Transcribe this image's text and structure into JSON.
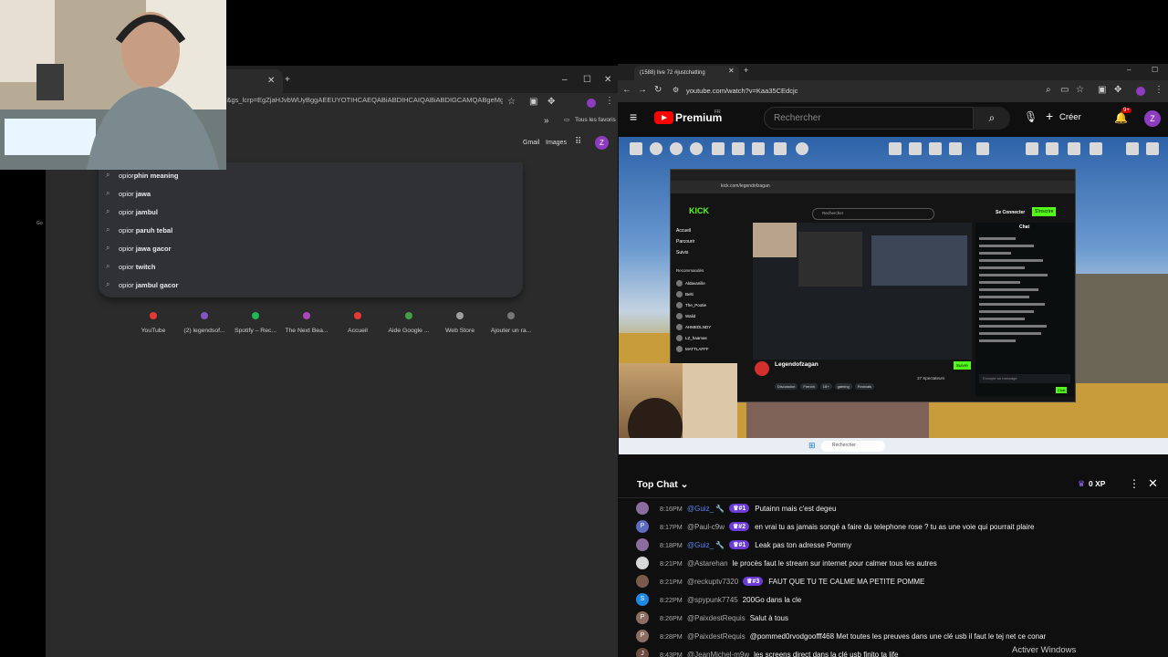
{
  "left_browser": {
    "url": "r&gs_lcrp=EgZjaHJvbWUyBggAEEUYOTIHCAEQABiABDIHCAIQABiABDIGCAMQABgeMgYIBBAA...",
    "bookmark": "Tous les favoris",
    "gmail_label": "Gmail",
    "images_label": "Images",
    "avatar_letter": "Z",
    "suggestions": [
      {
        "prefix": "opior",
        "bold": "phin meaning"
      },
      {
        "prefix": "opior ",
        "bold": "jawa"
      },
      {
        "prefix": "opior ",
        "bold": "jambul"
      },
      {
        "prefix": "opior ",
        "bold": "paruh tebal"
      },
      {
        "prefix": "opior ",
        "bold": "jawa gacor"
      },
      {
        "prefix": "opior ",
        "bold": "twitch"
      },
      {
        "prefix": "opior ",
        "bold": "jambul gacor"
      }
    ],
    "shortcuts": [
      "YouTube",
      "(2) legendsof...",
      "Spotify – Rec...",
      "The Next Bea...",
      "Accueil",
      "Aide Google ...",
      "Web Store",
      "Ajouter un ra..."
    ],
    "shortcut_colors": [
      "#e53935",
      "#7e57c2",
      "#1db954",
      "#ab47bc",
      "#e53935",
      "#43a047",
      "#9e9e9e",
      "#777777"
    ]
  },
  "right_browser": {
    "tab_title": "(1588) live 72 #justchatting",
    "url": "youtube.com/watch?v=Kaa35CEdcjc",
    "brand": "Premium",
    "region": "FR",
    "search_placeholder": "Rechercher",
    "create_label": "Créer",
    "notif_count": "9+",
    "avatar_letter": "Z"
  },
  "video": {
    "kick": {
      "logo": "KICK",
      "url": "kick.com/legendofzagan",
      "search": "Rechercher",
      "connect": "Se Connecter",
      "signup": "S'inscrire",
      "nav": [
        "Accueil",
        "Parcourir",
        "Suivis"
      ],
      "recommended_title": "Recommandés",
      "recommended": [
        "Aldavanille",
        "Belti",
        "The_Pootie",
        "Walid",
        "AHMEDLNDY",
        "LZ_haamas",
        "MATTLAFFF"
      ],
      "streamer": "Legendofzagan",
      "follow": "Suivre",
      "chat_title": "Chat",
      "viewers": "37 Spectateurs",
      "chat_placeholder": "Envoyer un message",
      "chat_button": "Chat",
      "tags": [
        "Discussion",
        "French",
        "18+",
        "gaming",
        "Francais"
      ]
    },
    "taskbar_search": "Rechercher"
  },
  "chat": {
    "title": "Top Chat",
    "xp": "0 XP",
    "messages": [
      {
        "time": "8:16 PM",
        "author": "@Guiz_",
        "mod": true,
        "rank": "#1",
        "text": "Putainn mais c'est degeu",
        "avatar_color": "#8a6d9e",
        "avatar_letter": ""
      },
      {
        "time": "8:17 PM",
        "author": "@Paul-c9w",
        "mod": false,
        "rank": "#2",
        "text": "en vrai tu as jamais songé a faire du telephone rose ? tu as une voie qui pourrait plaire",
        "avatar_color": "#5c6bc0",
        "avatar_letter": "P"
      },
      {
        "time": "8:18 PM",
        "author": "@Guiz_",
        "mod": true,
        "rank": "#1",
        "text": "Leak pas ton adresse Pommy",
        "avatar_color": "#8a6d9e",
        "avatar_letter": ""
      },
      {
        "time": "8:21 PM",
        "author": "@Astarehan",
        "mod": false,
        "rank": "",
        "text": "le procès faut le stream sur internet pour calmer tous les autres",
        "avatar_color": "#d8d8d8",
        "avatar_letter": ""
      },
      {
        "time": "8:21 PM",
        "author": "@reckuptv7320",
        "mod": false,
        "rank": "#3",
        "text": "FAUT QUE TU TE CALME MA PETITE POMME",
        "avatar_color": "#7a5a4a",
        "avatar_letter": ""
      },
      {
        "time": "8:22 PM",
        "author": "@spypunk7745",
        "mod": false,
        "rank": "",
        "text": "200Go dans la cle",
        "avatar_color": "#1e88e5",
        "avatar_letter": "S"
      },
      {
        "time": "8:26 PM",
        "author": "@PaixdestRequis",
        "mod": false,
        "rank": "",
        "text": "Salut à tous",
        "avatar_color": "#8d6e63",
        "avatar_letter": "P"
      },
      {
        "time": "8:28 PM",
        "author": "@PaixdestRequis",
        "mod": false,
        "rank": "",
        "text": "@pommed0rvodgoofff468 Met toutes les preuves dans une clé usb il faut le tej net ce conar",
        "avatar_color": "#8d6e63",
        "avatar_letter": "P"
      },
      {
        "time": "8:43 PM",
        "author": "@JeanMichel-m9w",
        "mod": false,
        "rank": "",
        "text": "les screens direct dans la clé usb finito ta life",
        "avatar_color": "#6d4c41",
        "avatar_letter": "J"
      }
    ]
  },
  "os": {
    "activate_windows": "Activer Windows"
  }
}
